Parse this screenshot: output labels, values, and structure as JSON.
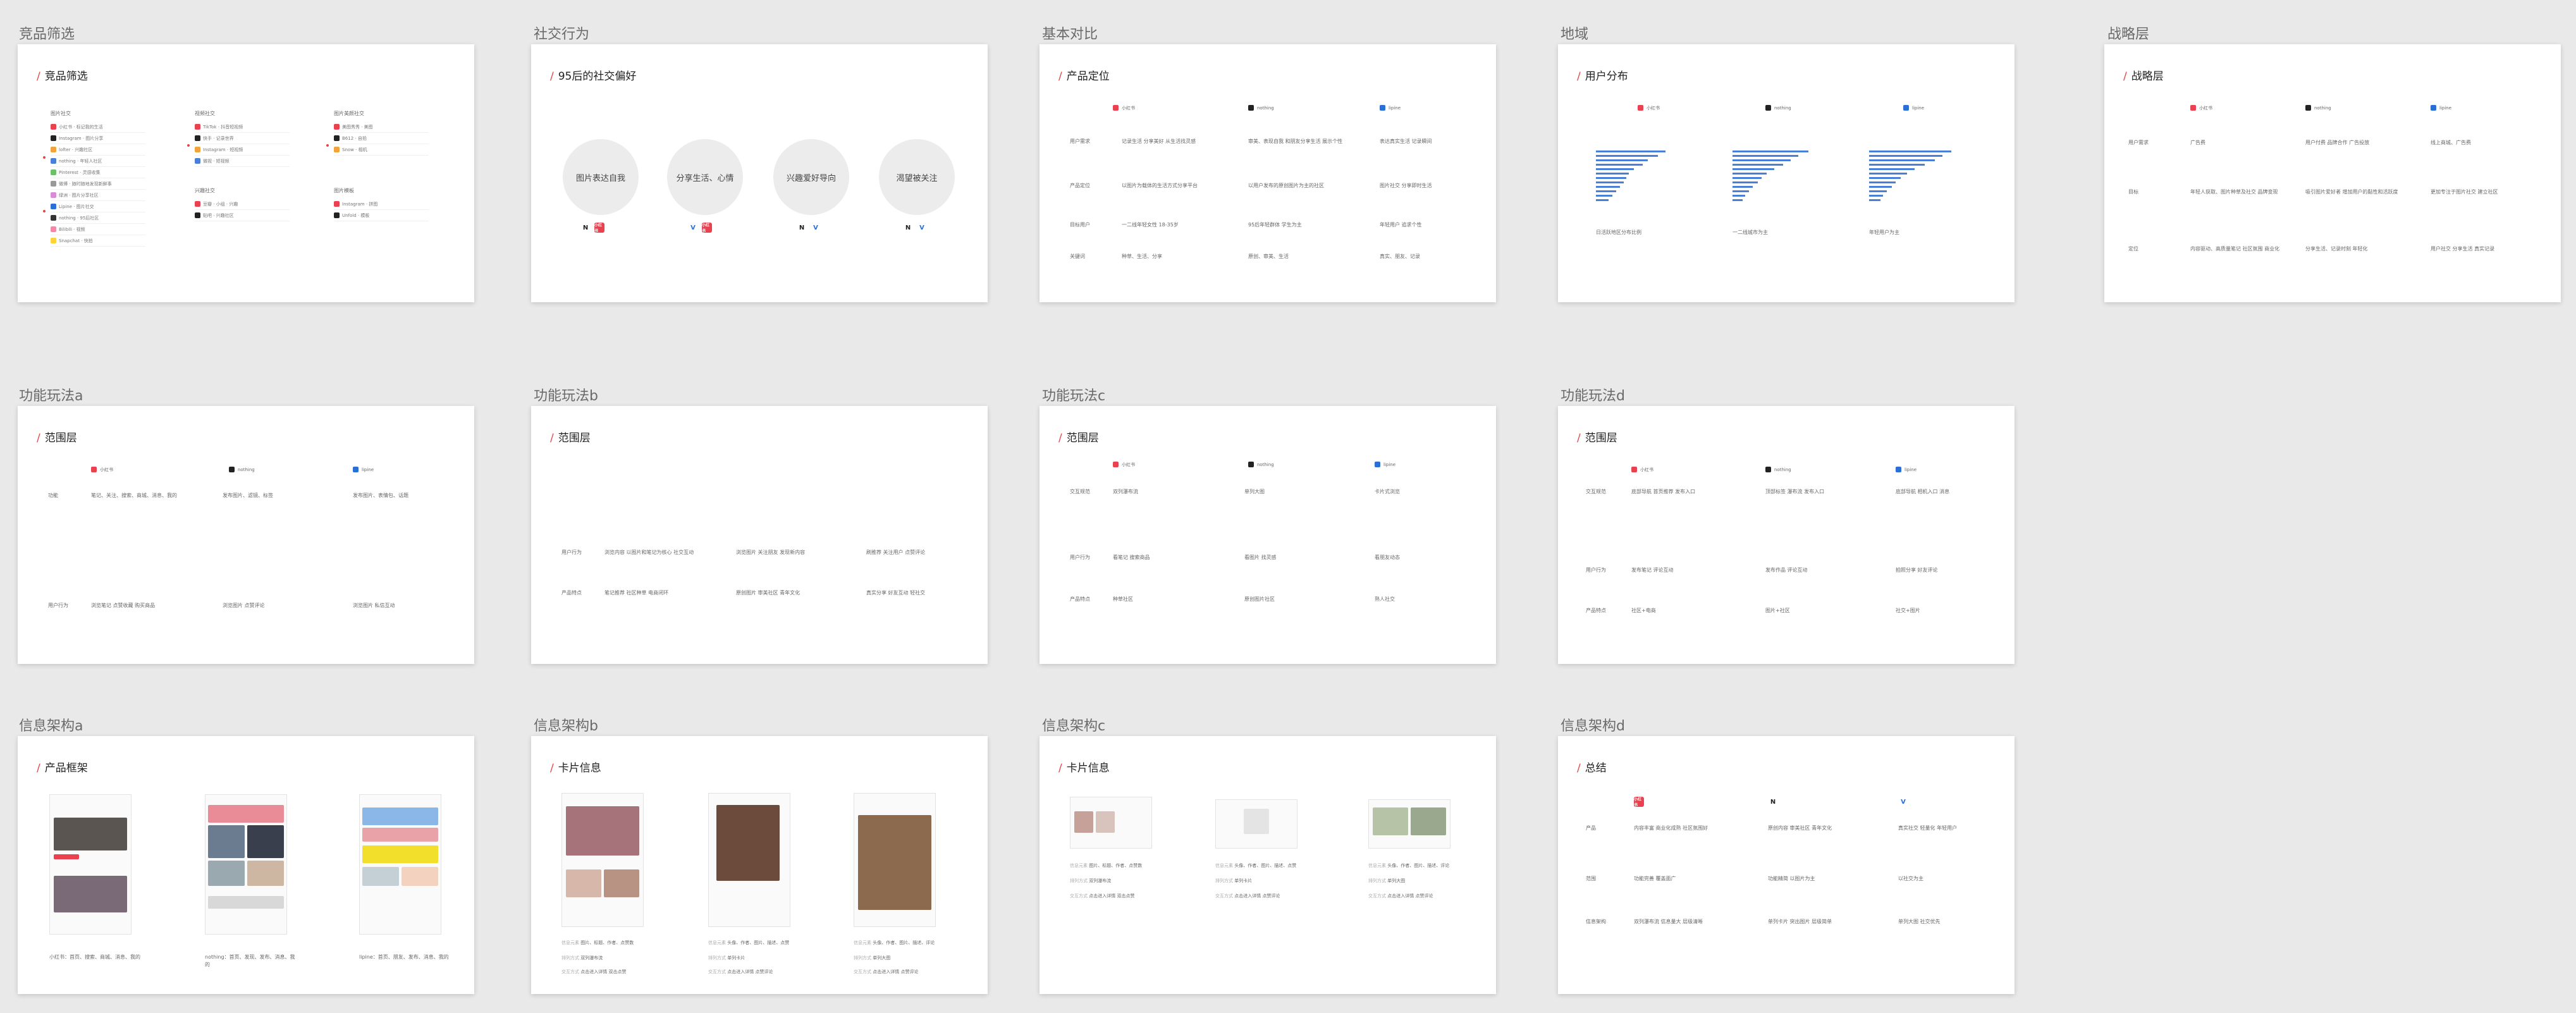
{
  "sections": {
    "jingpin": "竞品筛选",
    "shejiao": "社交行为",
    "jiben": "基本对比",
    "diyu": "地域",
    "zhanlue": "战略层",
    "gna": "功能玩法a",
    "gnb": "功能玩法b",
    "gnc": "功能玩法c",
    "gnd": "功能玩法d",
    "xxa": "信息架构a",
    "xxb": "信息架构b",
    "xxc": "信息架构c",
    "xxd": "信息架构d"
  },
  "titles": {
    "jingpin": "竞品筛选",
    "shejiao": "95后的社交偏好",
    "jiben": "产品定位",
    "diyu": "用户分布",
    "zhanlue": "战略层",
    "fanwei": "范围层",
    "kuangjia": "产品框架",
    "kapian": "卡片信息",
    "zongjie": "总结"
  },
  "apps": {
    "a": "小红书",
    "b": "nothing",
    "c": "lipine"
  },
  "colors": {
    "accent": "#e04848",
    "bar": "#4a7fd8",
    "badge_red": "#e9414f"
  },
  "jingpin_lists": [
    {
      "head": "图片社交",
      "rows": [
        "小红书 · 标记我的生活",
        "Instagram · 图片分享",
        "lofter · 兴趣社区",
        "nothing · 年轻人社区",
        "Pinterest · 灵感收集",
        "微博 · 随时随地发现新鲜事",
        "绿洲 · 图片分享社区",
        "Lipine · 图片社交",
        "nothing · 95后社区",
        "Bilibili · 视频",
        "Snapchat · 快拍"
      ]
    },
    {
      "head": "视频社交",
      "rows": [
        "TikTok · 抖音短视频",
        "快手 · 记录世界",
        "Instagram · 短视频",
        "微视 · 短视频"
      ]
    },
    {
      "head": "兴趣社交",
      "rows": [
        "豆瓣 · 小组 · 兴趣",
        "贴吧 · 兴趣社区"
      ]
    },
    {
      "head": "图片美颜社交",
      "rows": [
        "美图秀秀 · 美图",
        "B612 · 自拍",
        "Snow · 相机"
      ]
    },
    {
      "head": "图片模板",
      "rows": [
        "Instagram · 拼图",
        "Unfold · 模板"
      ]
    }
  ],
  "shejiao_circles": [
    "图片表达自我",
    "分享生活、心情",
    "兴趣爱好导向",
    "渴望被关注"
  ],
  "jiben_rows": [
    {
      "label": "用户需求",
      "cells": [
        "记录生活 分享美好 从生活找灵感",
        "审美、表现自我 和朋友分享生活 展示个性",
        "表达真实生活 记录瞬间"
      ]
    },
    {
      "label": "产品定位",
      "cells": [
        "以图片为载体的生活方式分享平台",
        "以用户发布的原创图片为主的社区",
        "图片社交 分享即时生活"
      ]
    },
    {
      "label": "目标用户",
      "cells": [
        "一二线年轻女性 18-35岁",
        "95后年轻群体 学生为主",
        "年轻用户 追求个性"
      ]
    },
    {
      "label": "关键词",
      "cells": [
        "种草、生活、分享",
        "原创、审美、生活",
        "真实、朋友、记录"
      ]
    }
  ],
  "diyu_captions": [
    "日活跃地区分布比例",
    "一二线城市为主",
    "年轻用户为主"
  ],
  "zhanlue_rows": [
    {
      "label": "用户需求",
      "cells": [
        "广告费",
        "用户付费 品牌合作 广告投放",
        "线上商城、广告费"
      ]
    },
    {
      "label": "目标",
      "cells": [
        "年轻人获取、图片种草及社交 品牌变现",
        "吸引图片爱好者 增加用户的黏性和活跃度",
        "更加专注于图片社交 建立社区"
      ]
    },
    {
      "label": "定位",
      "cells": [
        "内容驱动、高质量笔记 社区氛围 商业化",
        "分享生活、记录时刻 年轻化",
        "用户社交 分享生活 真实记录"
      ]
    }
  ],
  "gn_rows": {
    "a": [
      {
        "label": "功能",
        "cells": [
          "笔记、关注、搜索、商城、消息、我的",
          "发布图片、滤镜、标签",
          "发布图片、表情包、话题"
        ]
      },
      {
        "label": "用户行为",
        "cells": [
          "浏览笔记 点赞收藏 购买商品",
          "浏览图片 点赞评论",
          "浏览图片 私信互动"
        ]
      }
    ],
    "b": [
      {
        "label": "用户行为",
        "cells": [
          "浏览内容 以图片和笔记为核心 社交互动",
          "浏览图片 关注朋友 发现新内容",
          "刷推荐 关注用户 点赞评论"
        ]
      },
      {
        "label": "产品特点",
        "cells": [
          "笔记推荐 社区种草 电商闭环",
          "原创图片 审美社区 青年文化",
          "真实分享 好友互动 轻社交"
        ]
      }
    ],
    "c": [
      {
        "label": "交互规范",
        "cells": [
          "双列瀑布流",
          "单列大图",
          "卡片式浏览"
        ]
      },
      {
        "label": "用户行为",
        "cells": [
          "看笔记 搜索商品",
          "看图片 找灵感",
          "看朋友动态"
        ]
      },
      {
        "label": "产品特点",
        "cells": [
          "种草社区",
          "原创图片社区",
          "熟人社交"
        ]
      }
    ],
    "d": [
      {
        "label": "交互规范",
        "cells": [
          "底部导航 首页推荐 发布入口",
          "顶部标签 瀑布流 发布入口",
          "底部导航 相机入口 消息"
        ]
      },
      {
        "label": "用户行为",
        "cells": [
          "发布笔记 评论互动",
          "发布作品 评论互动",
          "拍照分享 好友评论"
        ]
      },
      {
        "label": "产品特点",
        "cells": [
          "社区+电商",
          "图片+社区",
          "社交+图片"
        ]
      }
    ]
  },
  "xxa_captions": [
    "小红书：首页、搜索、商城、消息、我的",
    "nothing：首页、发现、发布、消息、我的",
    "lipine：首页、朋友、发布、消息、我的"
  ],
  "card_meta": [
    {
      "label": "信息元素",
      "cells": [
        "图片、标题、作者、点赞数",
        "头像、作者、图片、描述、点赞",
        "头像、作者、图片、描述、评论"
      ]
    },
    {
      "label": "排列方式",
      "cells": [
        "双列瀑布流",
        "单列卡片",
        "单列大图"
      ]
    },
    {
      "label": "交互方式",
      "cells": [
        "点击进入详情 双击点赞",
        "点击进入详情 点赞评论",
        "点击进入详情 点赞评论"
      ]
    }
  ],
  "zongjie_rows": [
    {
      "label": "产品",
      "cells": [
        "内容丰富 商业化成熟 社区氛围好",
        "原创内容 审美社区 青年文化",
        "真实社交 轻量化 年轻用户"
      ]
    },
    {
      "label": "范围",
      "cells": [
        "功能完善 覆盖面广",
        "功能精简 以图片为主",
        "以社交为主"
      ]
    },
    {
      "label": "信息架构",
      "cells": [
        "双列瀑布流 信息量大 层级清晰",
        "单列卡片 突出图片 层级简单",
        "单列大图 社交优先"
      ]
    }
  ],
  "brands": {
    "r": "小红书",
    "k": "N",
    "b": "V"
  }
}
